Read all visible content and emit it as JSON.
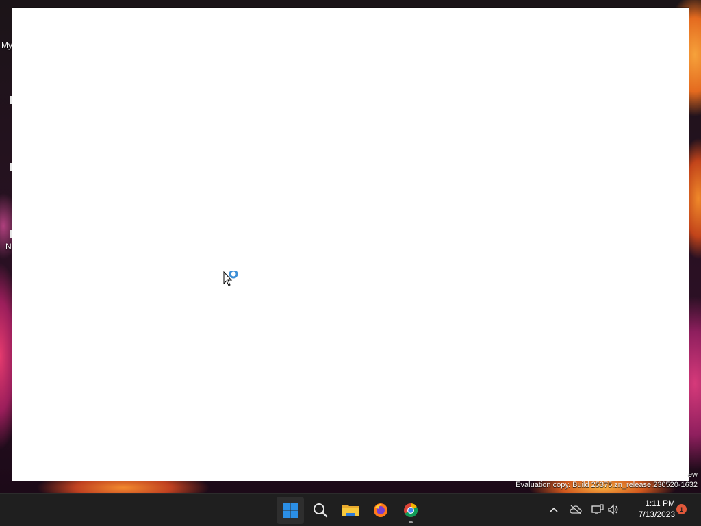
{
  "desktop": {
    "labels": [
      "My",
      "N"
    ]
  },
  "watermark": {
    "line1": "ew",
    "line2": "Evaluation copy. Build 25375.zn_release.230520-1632"
  },
  "taskbar": {
    "apps": [
      {
        "name": "Start",
        "icon": "windows-logo-icon"
      },
      {
        "name": "Search",
        "icon": "search-icon"
      },
      {
        "name": "File Explorer",
        "icon": "folder-icon"
      },
      {
        "name": "Firefox",
        "icon": "firefox-icon"
      },
      {
        "name": "Google Chrome",
        "icon": "chrome-icon"
      }
    ],
    "tray": {
      "icons": [
        "chevron-up-icon",
        "cloud-offline-icon",
        "network-icon",
        "volume-icon"
      ],
      "time": "1:11 PM",
      "date": "7/13/2023",
      "notification_count": "1"
    }
  },
  "colors": {
    "taskbar_bg": "#1f1f1f",
    "start_blue": "#2b8fe6",
    "busy_ring": "#3d8fd6",
    "notification": "#e0583a"
  }
}
